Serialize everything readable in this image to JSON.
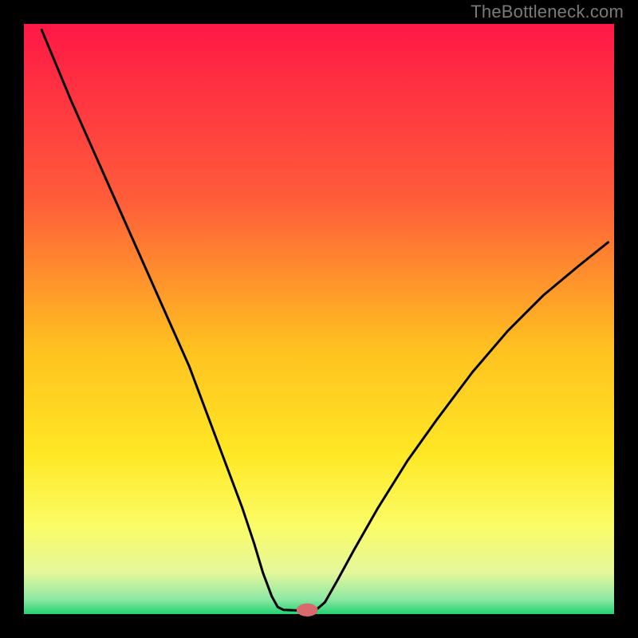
{
  "watermark": "TheBottleneck.com",
  "chart_data": {
    "type": "line",
    "title": "",
    "xlabel": "",
    "ylabel": "",
    "xlim": [
      0,
      100
    ],
    "ylim": [
      0,
      100
    ],
    "background_gradient_stops": [
      {
        "offset": 0.0,
        "color": "#ff1846"
      },
      {
        "offset": 0.3,
        "color": "#ff5d3a"
      },
      {
        "offset": 0.55,
        "color": "#ffc120"
      },
      {
        "offset": 0.73,
        "color": "#ffe825"
      },
      {
        "offset": 0.85,
        "color": "#fbfc66"
      },
      {
        "offset": 0.93,
        "color": "#e4f79b"
      },
      {
        "offset": 0.975,
        "color": "#8de8a4"
      },
      {
        "offset": 1.0,
        "color": "#23d36f"
      }
    ],
    "curve_left": [
      {
        "x": 3,
        "y": 99
      },
      {
        "x": 8,
        "y": 87
      },
      {
        "x": 12,
        "y": 78
      },
      {
        "x": 16,
        "y": 69
      },
      {
        "x": 20,
        "y": 60
      },
      {
        "x": 24,
        "y": 51
      },
      {
        "x": 28,
        "y": 42
      },
      {
        "x": 31,
        "y": 34
      },
      {
        "x": 34,
        "y": 26
      },
      {
        "x": 37,
        "y": 18
      },
      {
        "x": 39,
        "y": 12
      },
      {
        "x": 40.5,
        "y": 7
      },
      {
        "x": 42,
        "y": 3
      },
      {
        "x": 43,
        "y": 1.2
      },
      {
        "x": 44,
        "y": 0.7
      }
    ],
    "curve_flat": [
      {
        "x": 44,
        "y": 0.7
      },
      {
        "x": 47,
        "y": 0.6
      },
      {
        "x": 49.5,
        "y": 0.7
      }
    ],
    "curve_right": [
      {
        "x": 49.5,
        "y": 0.7
      },
      {
        "x": 51,
        "y": 2.0
      },
      {
        "x": 53,
        "y": 5.5
      },
      {
        "x": 56,
        "y": 11
      },
      {
        "x": 60,
        "y": 18
      },
      {
        "x": 65,
        "y": 26
      },
      {
        "x": 70,
        "y": 33
      },
      {
        "x": 76,
        "y": 41
      },
      {
        "x": 82,
        "y": 48
      },
      {
        "x": 88,
        "y": 54
      },
      {
        "x": 94,
        "y": 59
      },
      {
        "x": 99,
        "y": 63
      }
    ],
    "marker": {
      "x": 48,
      "y": 0.7,
      "rx": 1.8,
      "ry": 1.1,
      "color": "#d86a6e"
    }
  }
}
